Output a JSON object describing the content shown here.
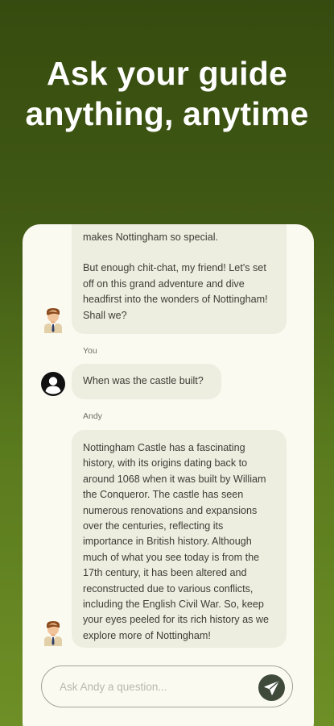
{
  "headline": {
    "line1": "Ask your guide",
    "line2": "anything, anytime"
  },
  "chat": {
    "messages": [
      {
        "sender": "Andy",
        "paragraphs": [
          "makes Nottingham so special.",
          "But enough chit-chat, my friend! Let's set off on this grand adventure and dive headfirst into the wonders of Nottingham! Shall we?"
        ]
      },
      {
        "sender": "You",
        "text": "When was the castle built?"
      },
      {
        "sender": "Andy",
        "text": "Nottingham Castle has a fascinating history, with its origins dating back to around 1068 when it was built by William the Conqueror. The castle has seen numerous renovations and expansions over the centuries, reflecting its importance in British history. Although much of what you see today is from the 17th century, it has been altered and reconstructed due to various conflicts, including the English Civil War. So, keep your eyes peeled for its rich history as we explore more of Nottingham!"
      }
    ]
  },
  "input": {
    "placeholder": "Ask Andy a question..."
  },
  "icons": {
    "guide_avatar": "guide-avatar-icon",
    "user_avatar": "user-avatar-icon",
    "send": "send-icon"
  },
  "colors": {
    "background_top": "#364b0f",
    "background_bottom": "#6e8f26",
    "card": "#fafaf1",
    "bubble": "#edeee0",
    "send_button": "#3f4a3b"
  }
}
